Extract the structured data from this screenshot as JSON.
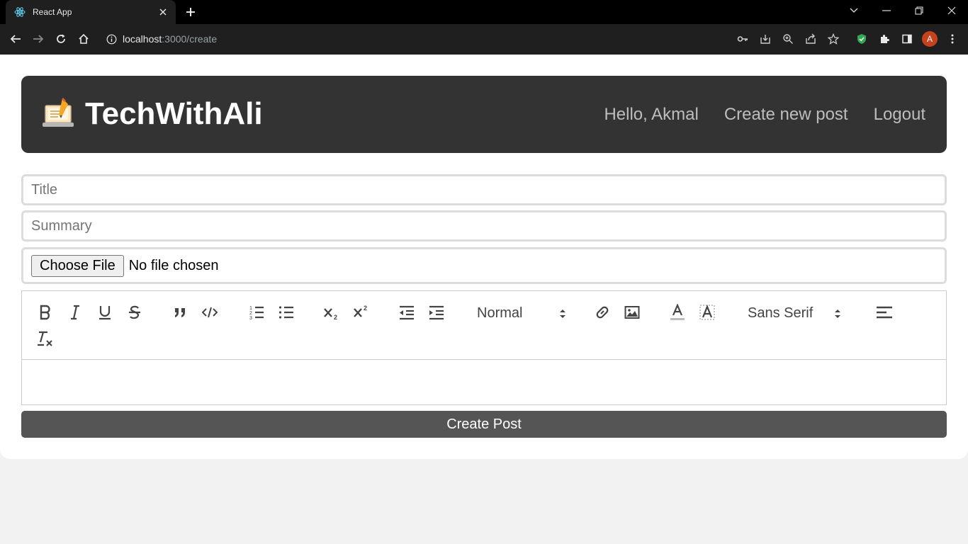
{
  "browser": {
    "tab_title": "React App",
    "url_host": "localhost",
    "url_path": ":3000/create",
    "avatar_letter": "A"
  },
  "header": {
    "brand": "TechWithAli",
    "nav": {
      "greeting": "Hello, Akmal",
      "create_post": "Create new post",
      "logout": "Logout"
    }
  },
  "form": {
    "title_placeholder": "Title",
    "summary_placeholder": "Summary",
    "file_button": "Choose File",
    "file_status": "No file chosen",
    "editor": {
      "header_picker": "Normal",
      "font_picker": "Sans Serif",
      "tools": [
        "bold-icon",
        "italic-icon",
        "underline-icon",
        "strike-icon",
        "blockquote-icon",
        "code-block-icon",
        "ordered-list-icon",
        "bullet-list-icon",
        "subscript-icon",
        "superscript-icon",
        "outdent-icon",
        "indent-icon",
        "link-icon",
        "image-icon",
        "text-color-icon",
        "background-color-icon",
        "align-icon",
        "clean-format-icon"
      ]
    },
    "submit_label": "Create Post"
  },
  "colors": {
    "header_bg": "#333333",
    "submit_bg": "#555555",
    "avatar_bg": "#c5421c"
  }
}
